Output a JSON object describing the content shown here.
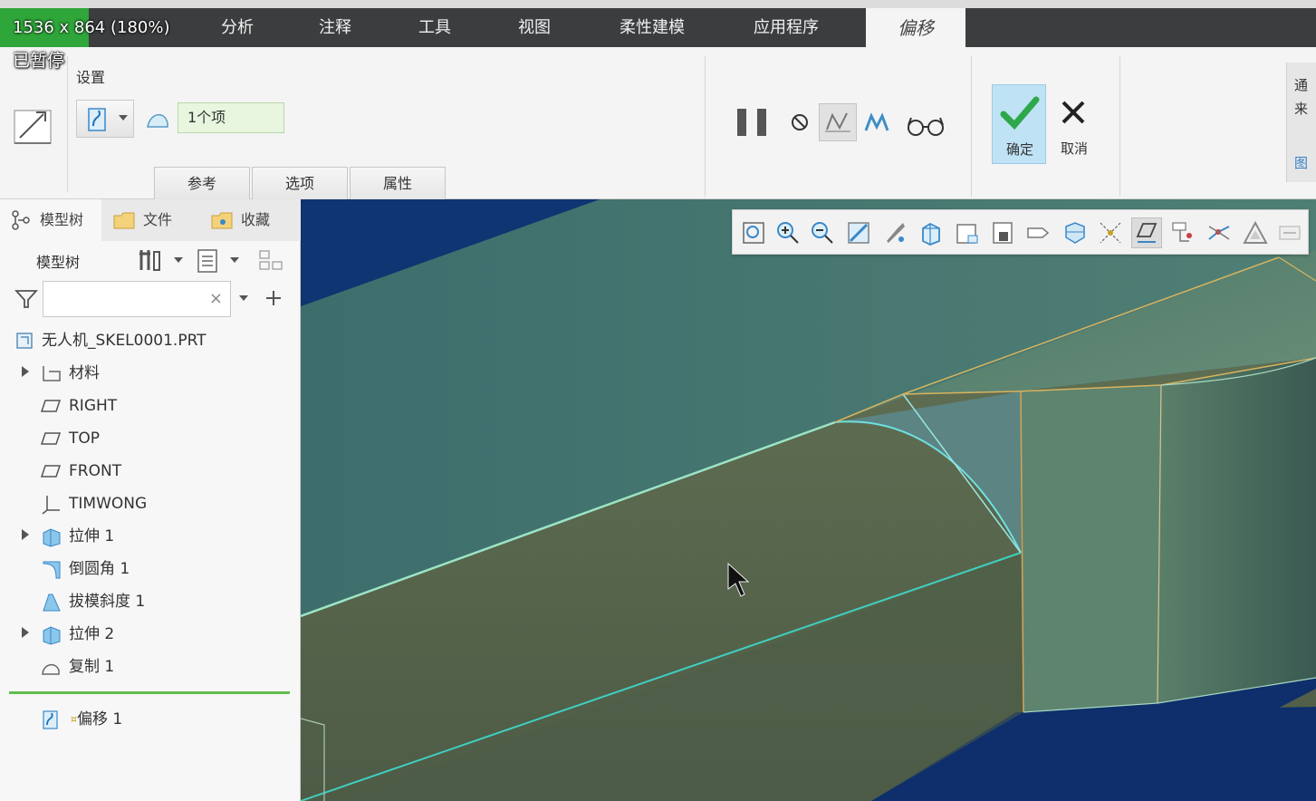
{
  "overlay": {
    "size_text": "1536 x 864 (180%)",
    "paused_text": "已暂停"
  },
  "menubar": {
    "items": [
      "分析",
      "注释",
      "工具",
      "视图",
      "柔性建模",
      "应用程序"
    ],
    "active": "偏移"
  },
  "ribbon": {
    "settings_label": "设置",
    "reference_value": "1个项",
    "tabs": [
      "参考",
      "选项",
      "属性"
    ],
    "ok_label": "确定",
    "cancel_label": "取消",
    "right_panel_text": [
      "通",
      "来",
      "图"
    ]
  },
  "left_panel": {
    "tabs": [
      "模型树",
      "文件",
      "收藏"
    ],
    "model_tree_label": "模型树",
    "search_clear": "×",
    "tree": [
      {
        "label": "无人机_SKEL0001.PRT",
        "icon": "part-icon",
        "expandable": false,
        "indent": 0
      },
      {
        "label": "材料",
        "icon": "material-icon",
        "expandable": true,
        "indent": 1
      },
      {
        "label": "RIGHT",
        "icon": "datum-plane-icon",
        "expandable": false,
        "indent": 1
      },
      {
        "label": "TOP",
        "icon": "datum-plane-icon",
        "expandable": false,
        "indent": 1
      },
      {
        "label": "FRONT",
        "icon": "datum-plane-icon",
        "expandable": false,
        "indent": 1
      },
      {
        "label": "TIMWONG",
        "icon": "coordinate-system-icon",
        "expandable": false,
        "indent": 1
      },
      {
        "label": "拉伸 1",
        "icon": "extrude-icon",
        "expandable": true,
        "indent": 1
      },
      {
        "label": "倒圆角 1",
        "icon": "round-icon",
        "expandable": false,
        "indent": 1
      },
      {
        "label": "拔模斜度 1",
        "icon": "draft-icon",
        "expandable": false,
        "indent": 1
      },
      {
        "label": "拉伸 2",
        "icon": "extrude-icon",
        "expandable": true,
        "indent": 1
      },
      {
        "label": "复制 1",
        "icon": "copy-icon",
        "expandable": false,
        "indent": 1
      },
      {
        "label": "偏移 1",
        "icon": "offset-icon",
        "expandable": false,
        "indent": 1
      }
    ]
  },
  "colors": {
    "menubar": "#3b3d3f",
    "accent_green": "#2fa63a",
    "ok_bg": "#bfe2f5",
    "viewport_bg": "#0e2f6b",
    "model_face": "#4e7b6c"
  }
}
